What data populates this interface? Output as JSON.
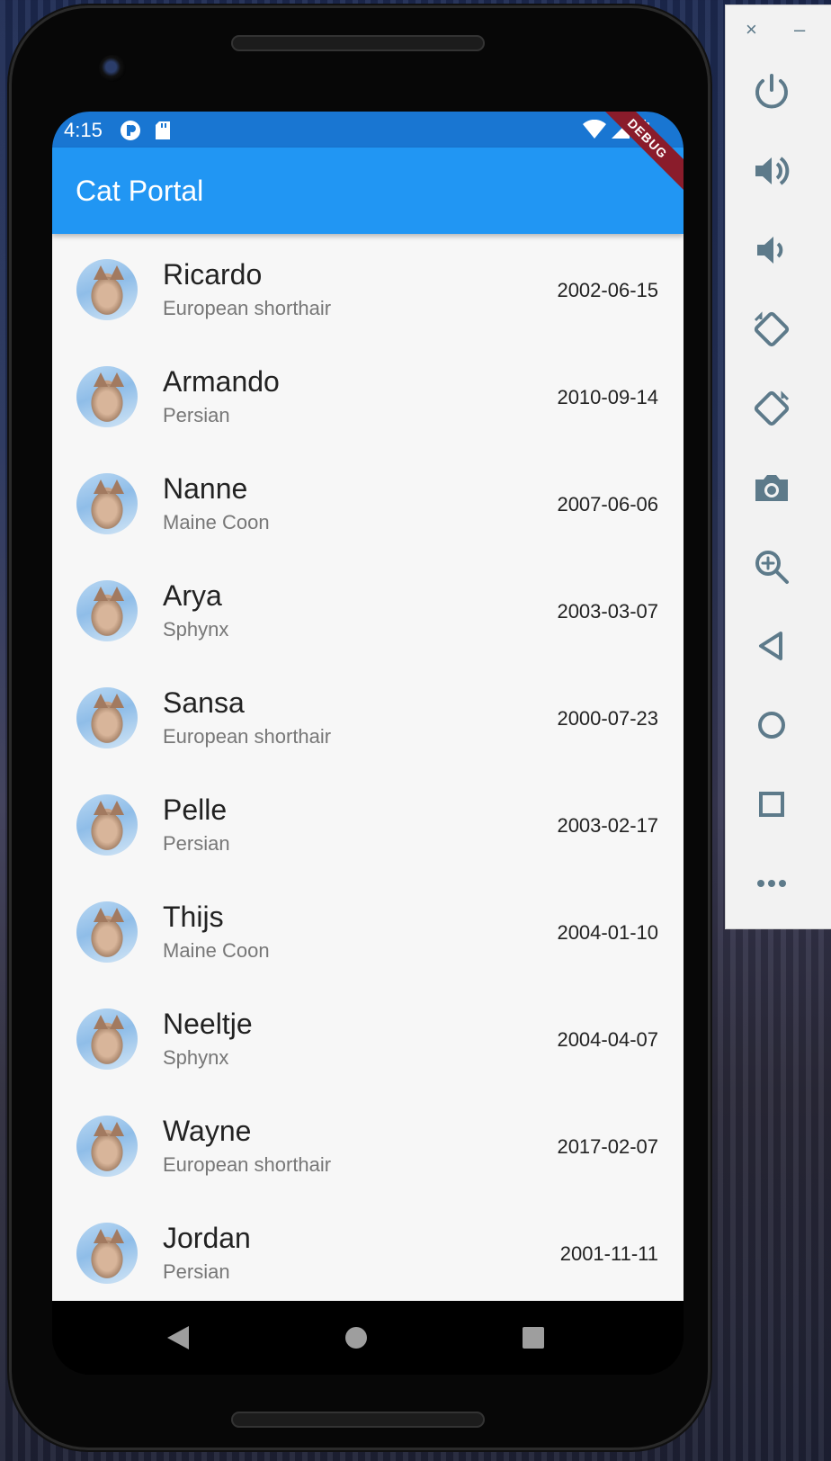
{
  "status_bar": {
    "time": "4:15"
  },
  "app_bar": {
    "title": "Cat Portal",
    "debug_label": "DEBUG"
  },
  "cats": [
    {
      "name": "Ricardo",
      "breed": "European shorthair",
      "birthdate": "2002-06-15"
    },
    {
      "name": "Armando",
      "breed": "Persian",
      "birthdate": "2010-09-14"
    },
    {
      "name": "Nanne",
      "breed": "Maine Coon",
      "birthdate": "2007-06-06"
    },
    {
      "name": "Arya",
      "breed": "Sphynx",
      "birthdate": "2003-03-07"
    },
    {
      "name": "Sansa",
      "breed": "European shorthair",
      "birthdate": "2000-07-23"
    },
    {
      "name": "Pelle",
      "breed": "Persian",
      "birthdate": "2003-02-17"
    },
    {
      "name": "Thijs",
      "breed": "Maine Coon",
      "birthdate": "2004-01-10"
    },
    {
      "name": "Neeltje",
      "breed": "Sphynx",
      "birthdate": "2004-04-07"
    },
    {
      "name": "Wayne",
      "breed": "European shorthair",
      "birthdate": "2017-02-07"
    },
    {
      "name": "Jordan",
      "breed": "Persian",
      "birthdate": "2001-11-11"
    }
  ],
  "emulator_panel": {
    "close_glyph": "×",
    "minimize_glyph": "–",
    "tools": [
      "power",
      "volume-up",
      "volume-down",
      "rotate-left",
      "rotate-right",
      "screenshot",
      "zoom",
      "back",
      "home",
      "overview",
      "more"
    ]
  },
  "colors": {
    "app_bar": "#2196f3",
    "status_bar": "#1976d2",
    "list_bg": "#f7f7f7",
    "panel_icon": "#5d7a8a"
  }
}
